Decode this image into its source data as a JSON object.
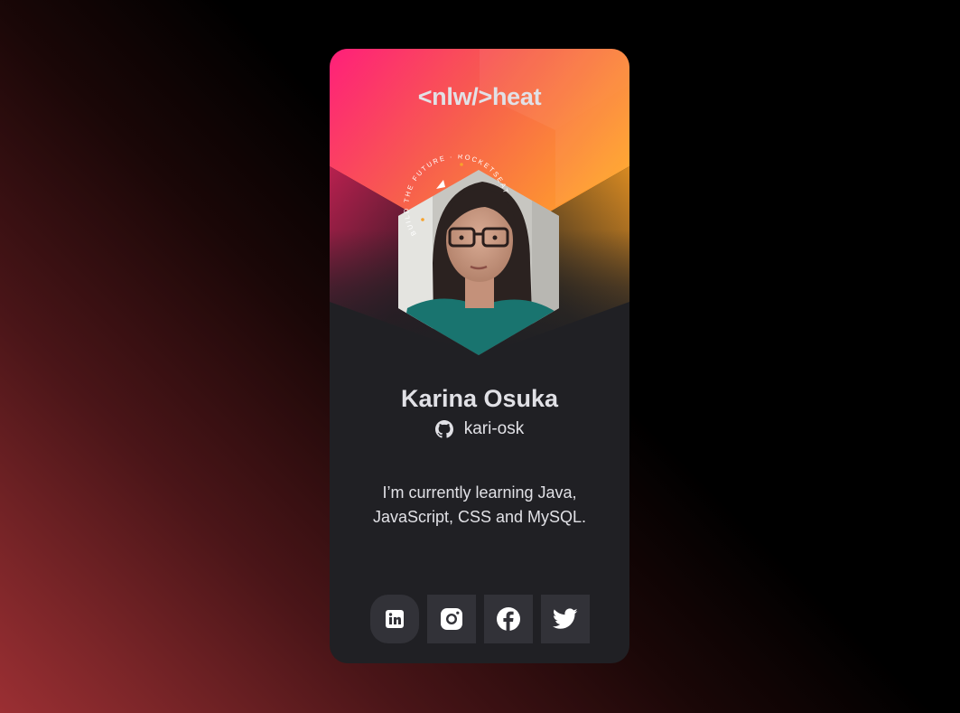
{
  "brand": "<nlw/>heat",
  "badge_text": "BUILD THE FUTURE · ROCKETSEAT",
  "profile": {
    "name": "Karina Osuka",
    "github_username": "kari-osk",
    "bio": "I’m currently learning Java, JavaScript, CSS and MySQL."
  },
  "icons": {
    "github": "github-icon",
    "linkedin": "linkedin-icon",
    "instagram": "instagram-icon",
    "facebook": "facebook-icon",
    "twitter": "twitter-icon"
  },
  "colors": {
    "background_start": "#9b2f33",
    "background_end": "#000000",
    "card": "#202024",
    "social_button": "#323238",
    "text": "#e1e1e6",
    "gradient_pink": "#ff1f7a",
    "gradient_orange": "#ffa12b"
  }
}
